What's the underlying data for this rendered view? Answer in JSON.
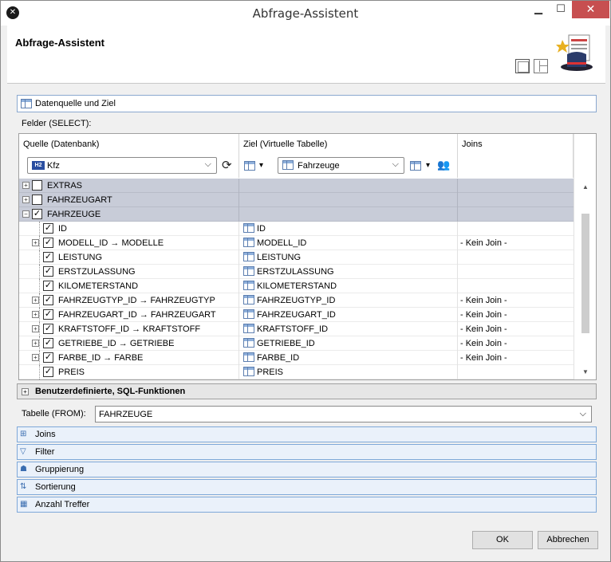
{
  "window": {
    "title": "Abfrage-Assistent"
  },
  "header": {
    "title": "Abfrage-Assistent"
  },
  "section_top": {
    "label": "Datenquelle und Ziel"
  },
  "felder_label": "Felder (SELECT):",
  "columns": {
    "source": "Quelle (Datenbank)",
    "target": "Ziel (Virtuelle Tabelle)",
    "joins": "Joins"
  },
  "source_combo": {
    "badge": "H2",
    "value": "Kfz"
  },
  "target_combo": {
    "value": "Fahrzeuge"
  },
  "groups": [
    {
      "label": "EXTRAS",
      "checked": false,
      "expanded": false
    },
    {
      "label": "FAHRZEUGART",
      "checked": false,
      "expanded": false
    },
    {
      "label": "FAHRZEUGE",
      "checked": true,
      "expanded": true
    }
  ],
  "rows": [
    {
      "source": "ID",
      "target": "ID",
      "join": "",
      "expandable": false
    },
    {
      "source": "MODELL_ID → MODELLE",
      "target": "MODELL_ID",
      "join": "- Kein Join -",
      "expandable": true
    },
    {
      "source": "LEISTUNG",
      "target": "LEISTUNG",
      "join": "",
      "expandable": false
    },
    {
      "source": "ERSTZULASSUNG",
      "target": "ERSTZULASSUNG",
      "join": "",
      "expandable": false
    },
    {
      "source": "KILOMETERSTAND",
      "target": "KILOMETERSTAND",
      "join": "",
      "expandable": false
    },
    {
      "source": "FAHRZEUGTYP_ID → FAHRZEUGTYP",
      "target": "FAHRZEUGTYP_ID",
      "join": "- Kein Join -",
      "expandable": true
    },
    {
      "source": "FAHRZEUGART_ID → FAHRZEUGART",
      "target": "FAHRZEUGART_ID",
      "join": "- Kein Join -",
      "expandable": true
    },
    {
      "source": "KRAFTSTOFF_ID → KRAFTSTOFF",
      "target": "KRAFTSTOFF_ID",
      "join": "- Kein Join -",
      "expandable": true
    },
    {
      "source": "GETRIEBE_ID → GETRIEBE",
      "target": "GETRIEBE_ID",
      "join": "- Kein Join -",
      "expandable": true
    },
    {
      "source": "FARBE_ID → FARBE",
      "target": "FARBE_ID",
      "join": "- Kein Join -",
      "expandable": true
    },
    {
      "source": "PREIS",
      "target": "PREIS",
      "join": "",
      "expandable": false
    }
  ],
  "custom_section": {
    "label": "Benutzerdefinierte, SQL-Funktionen"
  },
  "from": {
    "label": "Tabelle (FROM):",
    "value": "FAHRZEUGE"
  },
  "sections": [
    {
      "name": "joins",
      "label": "Joins",
      "icon": "joins-icon"
    },
    {
      "name": "filter",
      "label": "Filter",
      "icon": "filter-icon"
    },
    {
      "name": "grouping",
      "label": "Gruppierung",
      "icon": "grouping-icon"
    },
    {
      "name": "sorting",
      "label": "Sortierung",
      "icon": "sorting-icon"
    },
    {
      "name": "hits",
      "label": "Anzahl Treffer",
      "icon": "hits-icon"
    }
  ],
  "buttons": {
    "ok": "OK",
    "cancel": "Abbrechen"
  },
  "colors": {
    "group_row": "#c8ccd8",
    "close_button": "#c74f50",
    "section_blue": "#7ea8d8"
  }
}
